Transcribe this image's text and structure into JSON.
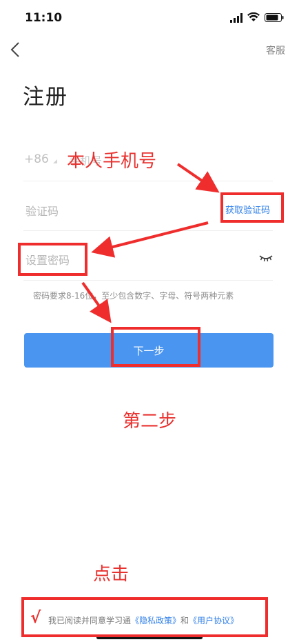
{
  "status_bar": {
    "time": "11:10"
  },
  "nav": {
    "service_label": "客服"
  },
  "page": {
    "title": "注册"
  },
  "form": {
    "country_code": "+86",
    "phone_placeholder": "手机号",
    "code_placeholder": "验证码",
    "get_code_label": "获取验证码",
    "password_placeholder": "设置密码",
    "password_hint": "密码要求8-16位，至少包含数字、字母、符号两种元素",
    "next_label": "下一步"
  },
  "agreement": {
    "prefix": "我已阅读并同意学习通",
    "privacy_link": "《隐私政策》",
    "conjunction": "和",
    "user_link": "《用户协议》"
  },
  "annotations": {
    "phone_note": "本人手机号",
    "step_note": "第二步",
    "click_note": "点击",
    "check_mark": "√"
  },
  "colors": {
    "accent": "#4a95f0",
    "link": "#2f7fe8",
    "annotation": "#e8322f"
  }
}
